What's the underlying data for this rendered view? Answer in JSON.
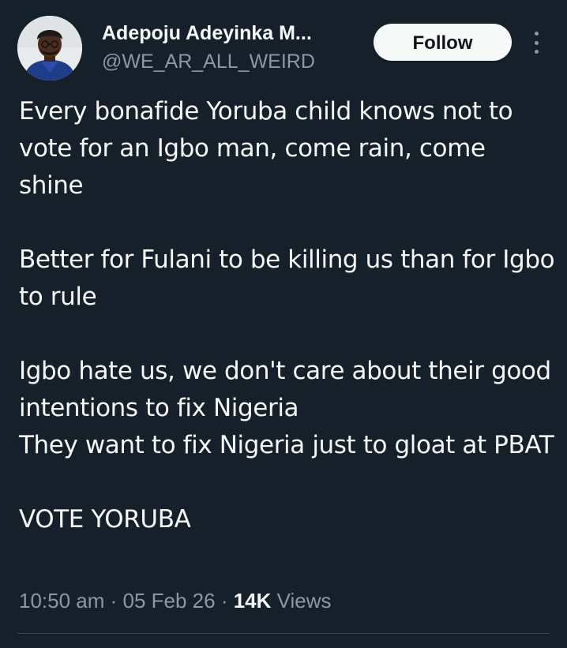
{
  "author": {
    "display_name": "Adepoju Adeyinka M...",
    "handle": "@WE_AR_ALL_WEIRD",
    "avatar_icon": "user-avatar"
  },
  "actions": {
    "follow_label": "Follow",
    "more_icon": "more-vertical-icon"
  },
  "tweet": {
    "text": "Every bonafide Yoruba child knows not to vote for an Igbo man, come rain, come shine\n\nBetter for Fulani to be killing us than for Igbo to rule\n\nIgbo hate us, we don't care about their good intentions to fix Nigeria\nThey want to fix Nigeria just to gloat at PBAT\n\nVOTE YORUBA"
  },
  "meta": {
    "time": "10:50 am",
    "separator": " · ",
    "date": "05 Feb 26",
    "views_count": "14K",
    "views_label": " Views"
  },
  "colors": {
    "background": "#15202b",
    "text_primary": "#f7f9f9",
    "text_secondary": "#8b98a5",
    "divider": "#38444d",
    "button_bg": "#f7f9f9",
    "button_text": "#0f1419"
  }
}
